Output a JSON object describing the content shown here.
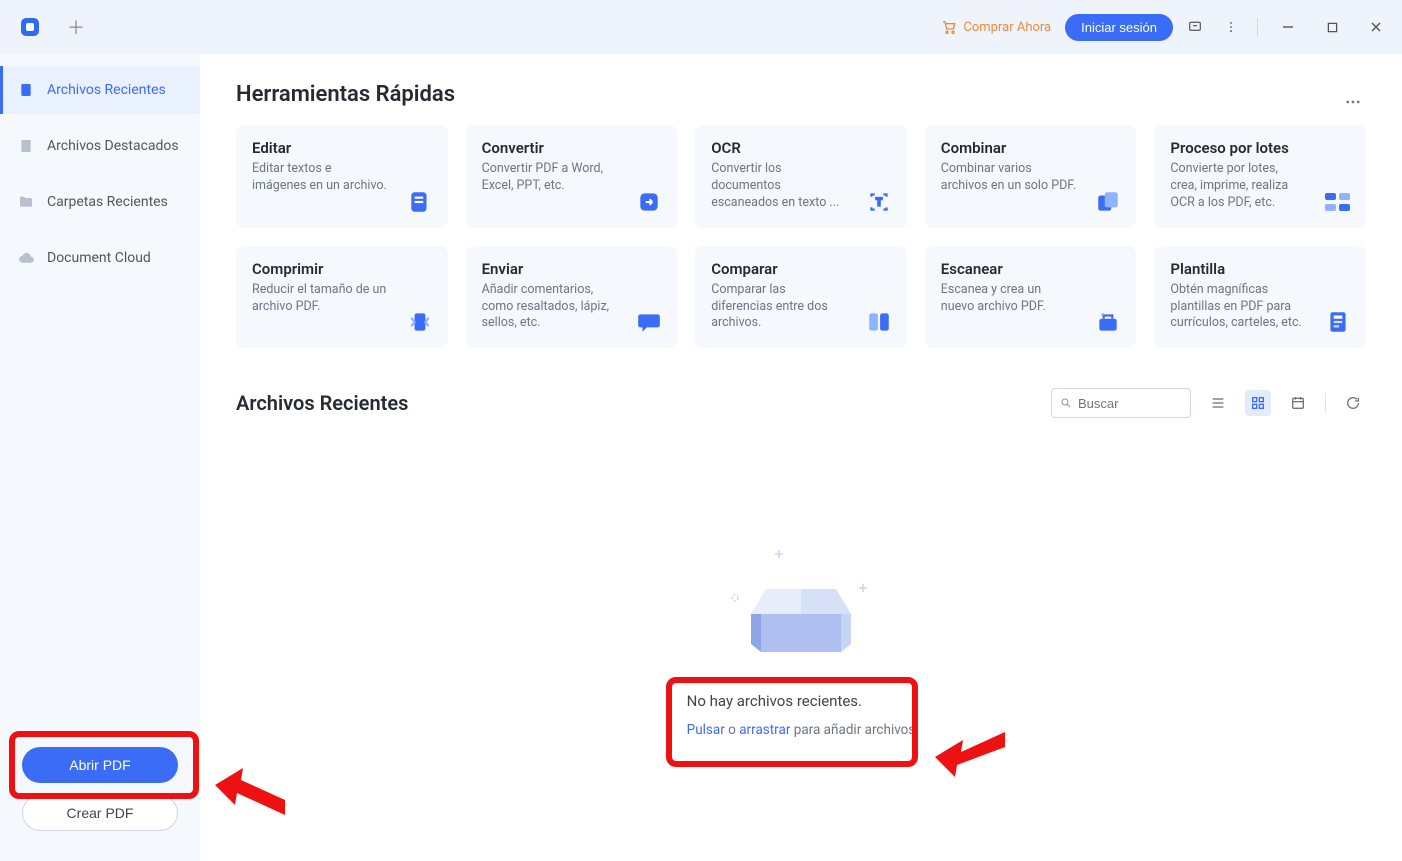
{
  "titlebar": {
    "buy_now": "Comprar Ahora",
    "login": "Iniciar sesión"
  },
  "sidebar": {
    "items": [
      {
        "label": "Archivos Recientes"
      },
      {
        "label": "Archivos Destacados"
      },
      {
        "label": "Carpetas Recientes"
      },
      {
        "label": "Document Cloud"
      }
    ],
    "open_pdf": "Abrir PDF",
    "create_pdf": "Crear PDF"
  },
  "tools": {
    "heading": "Herramientas Rápidas",
    "cards": [
      {
        "title": "Editar",
        "desc": "Editar textos e imágenes en un archivo."
      },
      {
        "title": "Convertir",
        "desc": "Convertir PDF a Word, Excel, PPT, etc."
      },
      {
        "title": "OCR",
        "desc": "Convertir los documentos escaneados en texto ..."
      },
      {
        "title": "Combinar",
        "desc": "Combinar varios archivos en un solo PDF."
      },
      {
        "title": "Proceso por lotes",
        "desc": "Convierte por lotes, crea, imprime, realiza OCR a los PDF, etc."
      },
      {
        "title": "Comprimir",
        "desc": "Reducir el tamaño de un archivo PDF."
      },
      {
        "title": "Enviar",
        "desc": "Añadir comentarios, como resaltados, lápiz, sellos, etc."
      },
      {
        "title": "Comparar",
        "desc": "Comparar las diferencias entre dos archivos."
      },
      {
        "title": "Escanear",
        "desc": "Escanea y crea un nuevo archivo PDF."
      },
      {
        "title": "Plantilla",
        "desc": "Obtén magníficas plantillas en PDF para currículos, carteles, etc."
      }
    ]
  },
  "recent": {
    "heading": "Archivos Recientes",
    "search_placeholder": "Buscar",
    "empty_title": "No hay archivos recientes.",
    "pulsar": "Pulsar",
    "o": " o ",
    "arrastrar": "arrastrar",
    "tail": " para añadir archivos"
  }
}
